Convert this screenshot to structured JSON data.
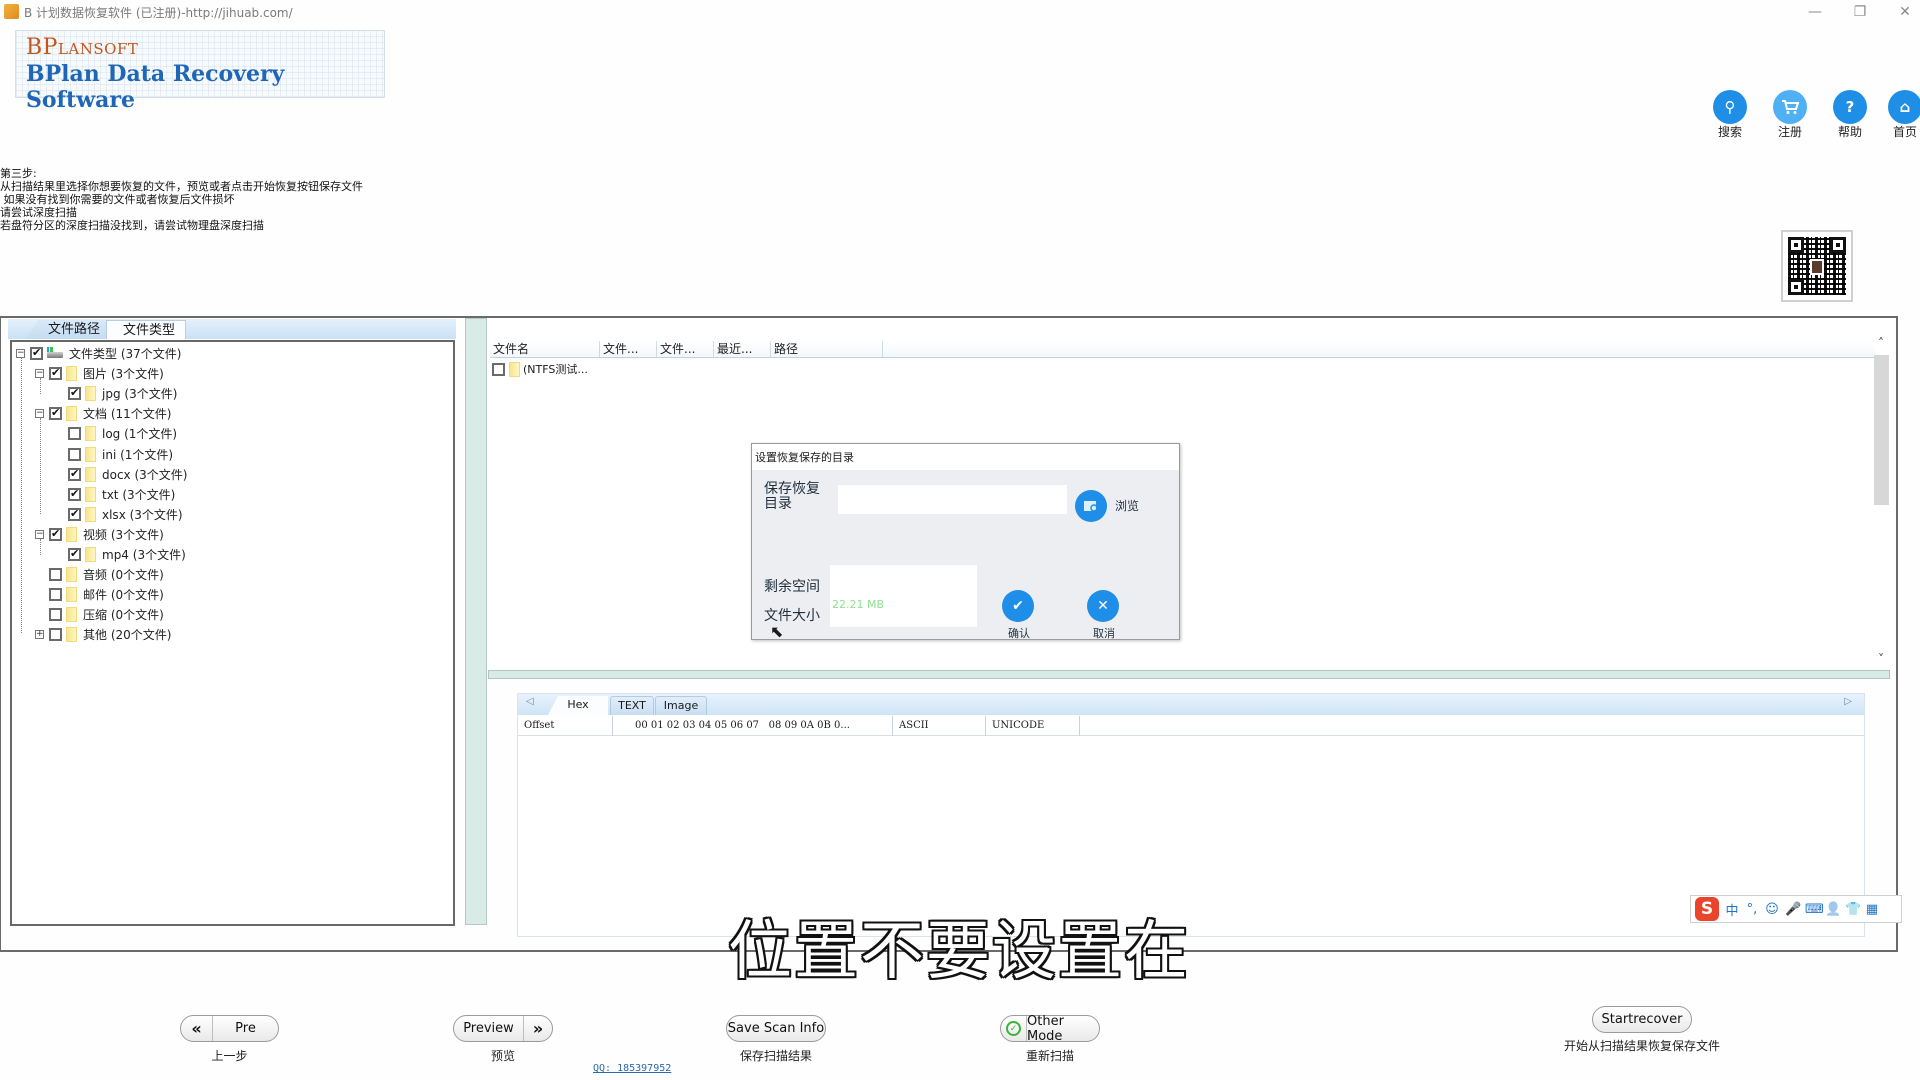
{
  "window": {
    "title": "B 计划数据恢复软件 (已注册)-http://jihuab.com/",
    "controls": {
      "minimize": "—",
      "restore": "❐",
      "close": "✕"
    }
  },
  "logo": {
    "brand": "BPlansoft",
    "product": "BPlan Data Recovery Software"
  },
  "top_nav": [
    {
      "icon": "search-icon",
      "glyph": "⚲",
      "label": "搜索"
    },
    {
      "icon": "cart-icon",
      "glyph": "🛒",
      "label": "注册"
    },
    {
      "icon": "help-icon",
      "glyph": "?",
      "label": "帮助"
    },
    {
      "icon": "home-icon",
      "glyph": "⌂",
      "label": "首页"
    }
  ],
  "instructions": "第三步:\n从扫描结果里选择你想要恢复的文件，预览或者点击开始恢复按钮保存文件\n 如果没有找到你需要的文件或者恢复后文件损坏\n请尝试深度扫描\n若盘符分区的深度扫描没找到，请尝试物理盘深度扫描",
  "left_tabs": [
    {
      "label": "文件路径",
      "active": false
    },
    {
      "label": "文件类型",
      "active": true
    }
  ],
  "tree": [
    {
      "level": 0,
      "label": "文件类型 (37个文件)",
      "checked": true,
      "expander": "−",
      "icon": "drive"
    },
    {
      "level": 1,
      "label": "图片 (3个文件)",
      "checked": true,
      "expander": "−",
      "icon": "folder"
    },
    {
      "level": 2,
      "label": "jpg (3个文件)",
      "checked": true,
      "expander": "",
      "icon": "folder"
    },
    {
      "level": 1,
      "label": "文档 (11个文件)",
      "checked": true,
      "expander": "−",
      "icon": "folder"
    },
    {
      "level": 2,
      "label": "log (1个文件)",
      "checked": false,
      "expander": "",
      "icon": "folder"
    },
    {
      "level": 2,
      "label": "ini (1个文件)",
      "checked": false,
      "expander": "",
      "icon": "folder"
    },
    {
      "level": 2,
      "label": "docx (3个文件)",
      "checked": true,
      "expander": "",
      "icon": "folder"
    },
    {
      "level": 2,
      "label": "txt (3个文件)",
      "checked": true,
      "expander": "",
      "icon": "folder"
    },
    {
      "level": 2,
      "label": "xlsx (3个文件)",
      "checked": true,
      "expander": "",
      "icon": "folder"
    },
    {
      "level": 1,
      "label": "视频 (3个文件)",
      "checked": true,
      "expander": "−",
      "icon": "folder"
    },
    {
      "level": 2,
      "label": "mp4 (3个文件)",
      "checked": true,
      "expander": "",
      "icon": "folder"
    },
    {
      "level": 1,
      "label": "音频 (0个文件)",
      "checked": false,
      "expander": "",
      "icon": "folder"
    },
    {
      "level": 1,
      "label": "邮件 (0个文件)",
      "checked": false,
      "expander": "",
      "icon": "folder"
    },
    {
      "level": 1,
      "label": "压缩 (0个文件)",
      "checked": false,
      "expander": "",
      "icon": "folder"
    },
    {
      "level": 1,
      "label": "其他 (20个文件)",
      "checked": false,
      "expander": "+",
      "icon": "folder"
    }
  ],
  "file_list": {
    "columns": [
      "文件名",
      "文件...",
      "文件...",
      "最近...",
      "路径"
    ],
    "rows": [
      {
        "name": "(NTFS测试...",
        "checked": false
      }
    ]
  },
  "dialog": {
    "title": "设置恢复保存的目录",
    "dir_label": "保存恢复\n目录",
    "dir_value": "",
    "browse_label": "浏览",
    "free_space_label": "剩余空间",
    "file_size_label": "文件大小",
    "file_size_value": "22.21 MB",
    "ok_label": "确认",
    "cancel_label": "取消"
  },
  "hex_view": {
    "tabs": [
      "Hex",
      "TEXT",
      "Image"
    ],
    "active_tab": "Hex",
    "columns": [
      "Offset",
      "00 01 02 03 04 05 06 07   08 09 0A 0B 0...",
      "ASCII",
      "UNICODE"
    ]
  },
  "ime_bar": {
    "logo": "S",
    "items": [
      "中",
      "°,",
      "☺",
      "🎤",
      "⌨",
      "👤",
      "👕",
      "▦"
    ]
  },
  "subtitle": "位置不要设置在",
  "bottom_buttons": [
    {
      "id": "pre",
      "label": "Pre",
      "caption": "上一步",
      "glyph": "«"
    },
    {
      "id": "preview",
      "label": "Preview",
      "caption": "预览",
      "glyph": "»"
    },
    {
      "id": "save-scan",
      "label": "Save Scan Info",
      "caption": "保存扫描结果"
    },
    {
      "id": "other-mode",
      "label": "Other Mode",
      "caption": "重新扫描",
      "glyph": "✓"
    },
    {
      "id": "startrecover",
      "label": "Startrecover",
      "caption": "开始从扫描结果恢复保存文件"
    }
  ],
  "qq_link": "QQ: 185397952",
  "colors": {
    "accent": "#1e8ee6",
    "brand_orange": "#c2561c",
    "brand_blue": "#1f67b6",
    "splitter": "#d8ebe6",
    "size_value": "#8fe08f"
  }
}
